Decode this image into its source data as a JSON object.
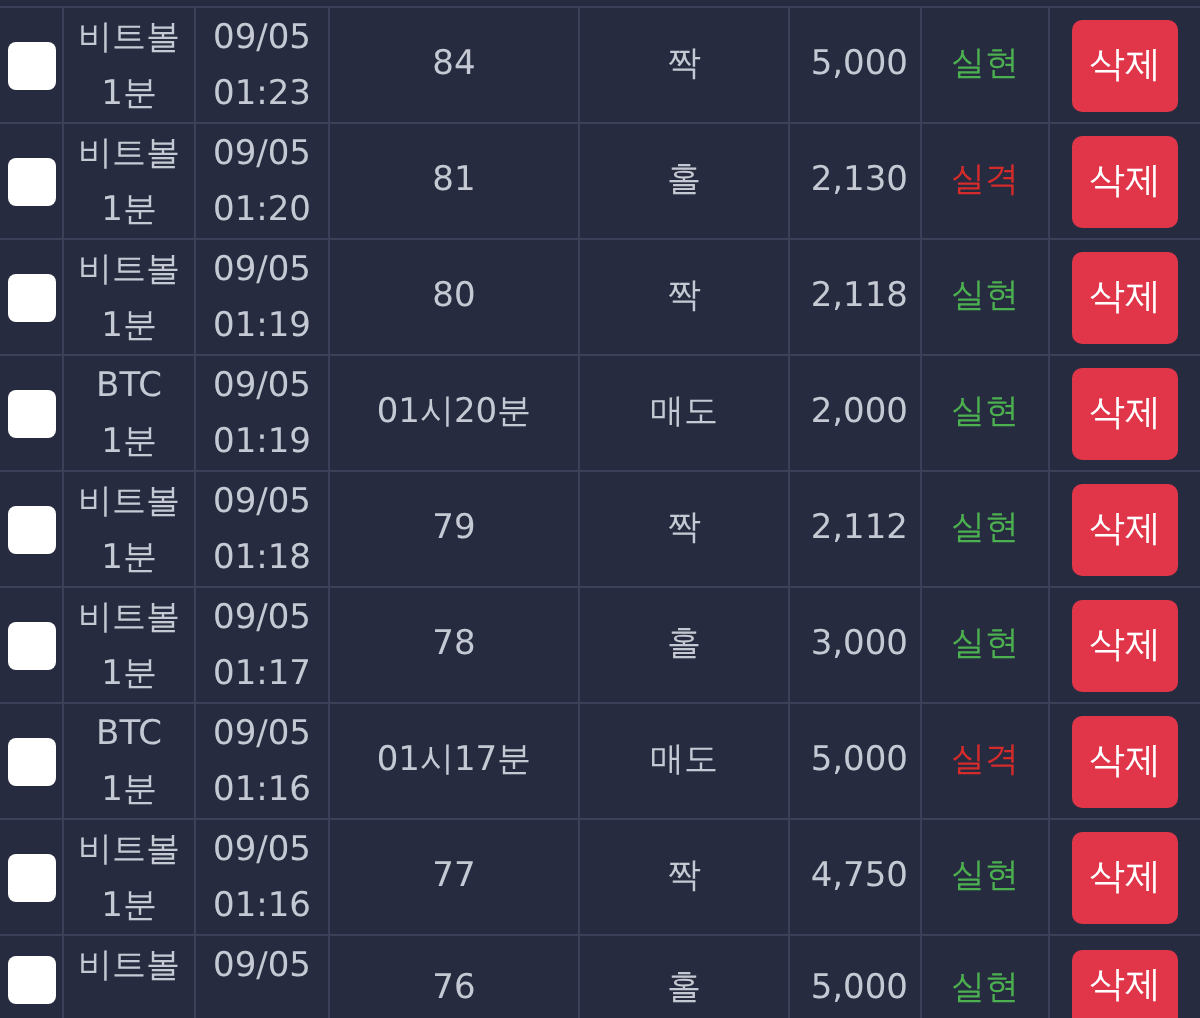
{
  "rows": [
    {
      "checked": false,
      "game": "비트볼",
      "unit": "1분",
      "date": "09/05",
      "time": "01:23",
      "round": "84",
      "pick": "짝",
      "amount": "5,000",
      "result": "실현",
      "color": "#4caf50",
      "action": "삭제"
    },
    {
      "checked": false,
      "game": "비트볼",
      "unit": "1분",
      "date": "09/05",
      "time": "01:20",
      "round": "81",
      "pick": "홀",
      "amount": "2,130",
      "result": "실격",
      "color": "#d52b2b",
      "action": "삭제"
    },
    {
      "checked": false,
      "game": "비트볼",
      "unit": "1분",
      "date": "09/05",
      "time": "01:19",
      "round": "80",
      "pick": "짝",
      "amount": "2,118",
      "result": "실현",
      "color": "#4caf50",
      "action": "삭제"
    },
    {
      "checked": false,
      "game": "BTC",
      "unit": "1분",
      "date": "09/05",
      "time": "01:19",
      "round": "01시20분",
      "pick": "매도",
      "amount": "2,000",
      "result": "실현",
      "color": "#4caf50",
      "action": "삭제"
    },
    {
      "checked": false,
      "game": "비트볼",
      "unit": "1분",
      "date": "09/05",
      "time": "01:18",
      "round": "79",
      "pick": "짝",
      "amount": "2,112",
      "result": "실현",
      "color": "#4caf50",
      "action": "삭제"
    },
    {
      "checked": false,
      "game": "비트볼",
      "unit": "1분",
      "date": "09/05",
      "time": "01:17",
      "round": "78",
      "pick": "홀",
      "amount": "3,000",
      "result": "실현",
      "color": "#4caf50",
      "action": "삭제"
    },
    {
      "checked": false,
      "game": "BTC",
      "unit": "1분",
      "date": "09/05",
      "time": "01:16",
      "round": "01시17분",
      "pick": "매도",
      "amount": "5,000",
      "result": "실격",
      "color": "#d52b2b",
      "action": "삭제"
    },
    {
      "checked": false,
      "game": "비트볼",
      "unit": "1분",
      "date": "09/05",
      "time": "01:16",
      "round": "77",
      "pick": "짝",
      "amount": "4,750",
      "result": "실현",
      "color": "#4caf50",
      "action": "삭제"
    },
    {
      "checked": false,
      "game": "비트볼",
      "date": "09/05",
      "round": "76",
      "pick": "홀",
      "amount": "5,000",
      "result": "실현",
      "color": "#4caf50",
      "action": "삭제"
    }
  ]
}
